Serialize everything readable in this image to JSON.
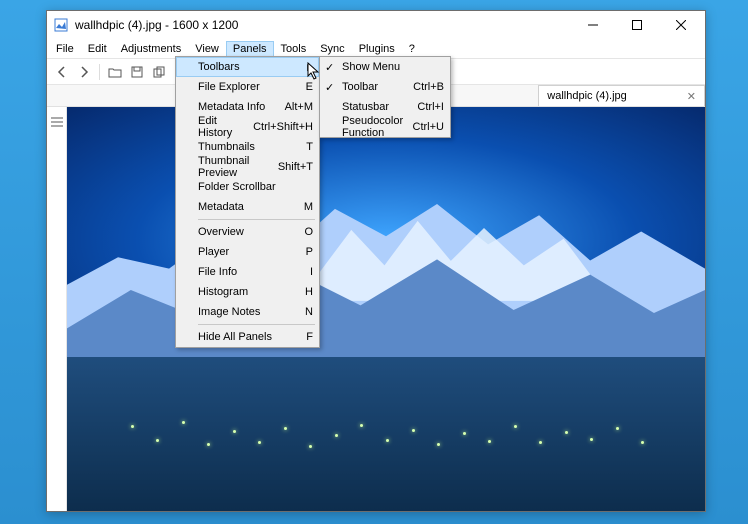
{
  "title": "wallhdpic (4).jpg - 1600 x 1200",
  "menubar": {
    "file": "File",
    "edit": "Edit",
    "adjustments": "Adjustments",
    "view": "View",
    "panels": "Panels",
    "tools": "Tools",
    "sync": "Sync",
    "plugins": "Plugins",
    "help": "?"
  },
  "tab": {
    "label": "wallhdpic (4).jpg"
  },
  "panels_menu": {
    "toolbars": {
      "label": "Toolbars"
    },
    "file_explorer": {
      "label": "File Explorer",
      "shortcut": "E"
    },
    "metadata_info": {
      "label": "Metadata Info",
      "shortcut": "Alt+M"
    },
    "edit_history": {
      "label": "Edit History",
      "shortcut": "Ctrl+Shift+H"
    },
    "thumbnails": {
      "label": "Thumbnails",
      "shortcut": "T"
    },
    "thumbnail_preview": {
      "label": "Thumbnail Preview",
      "shortcut": "Shift+T"
    },
    "folder_scrollbar": {
      "label": "Folder Scrollbar"
    },
    "metadata": {
      "label": "Metadata",
      "shortcut": "M"
    },
    "overview": {
      "label": "Overview",
      "shortcut": "O"
    },
    "player": {
      "label": "Player",
      "shortcut": "P"
    },
    "file_info": {
      "label": "File Info",
      "shortcut": "I"
    },
    "histogram": {
      "label": "Histogram",
      "shortcut": "H"
    },
    "image_notes": {
      "label": "Image Notes",
      "shortcut": "N"
    },
    "hide_all": {
      "label": "Hide All Panels",
      "shortcut": "F"
    }
  },
  "toolbars_submenu": {
    "show_menu": {
      "label": "Show Menu",
      "checked": true
    },
    "toolbar": {
      "label": "Toolbar",
      "shortcut": "Ctrl+B",
      "checked": true
    },
    "statusbar": {
      "label": "Statusbar",
      "shortcut": "Ctrl+I"
    },
    "pseudocolor": {
      "label": "Pseudocolor Function",
      "shortcut": "Ctrl+U"
    }
  }
}
